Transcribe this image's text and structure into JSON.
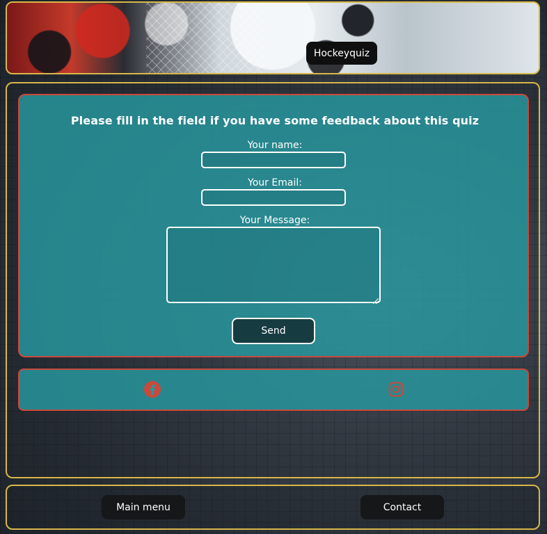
{
  "header": {
    "title": "Hockeyquiz"
  },
  "feedback": {
    "heading": "Please fill in the field if you have some feedback about this quiz",
    "name_label": "Your name:",
    "name_value": "",
    "email_label": "Your Email:",
    "email_value": "",
    "message_label": "Your Message:",
    "message_value": "",
    "send_label": "Send"
  },
  "social": {
    "icons": [
      "facebook-icon",
      "instagram-icon"
    ],
    "icon_color": "#c94a3c"
  },
  "footer": {
    "main_menu_label": "Main menu",
    "contact_label": "Contact"
  },
  "colors": {
    "frame_border": "#d8b84a",
    "card_border": "#c94a3c",
    "card_fill": "#2798a0",
    "button_dark": "#161719"
  }
}
